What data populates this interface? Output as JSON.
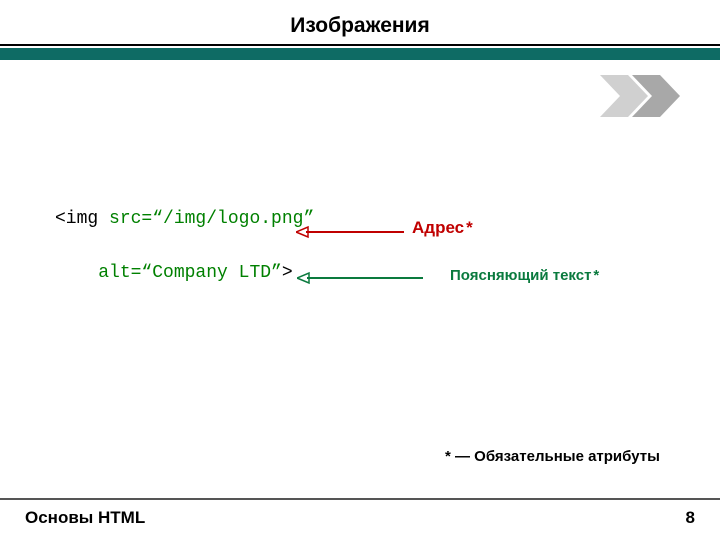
{
  "title": "Изображения",
  "code": {
    "line1_open": "<img ",
    "line1_attr": "src=“/img/logo.png”",
    "line2_attr": "alt=“Company LTD”",
    "line2_close": ">"
  },
  "labels": {
    "address": "Адрес",
    "alt_text": "Поясняющий текст",
    "asterisk": "*"
  },
  "footnote": "*  — Обязательные атрибуты",
  "footer": {
    "subject": "Основы HTML",
    "page": "8"
  }
}
